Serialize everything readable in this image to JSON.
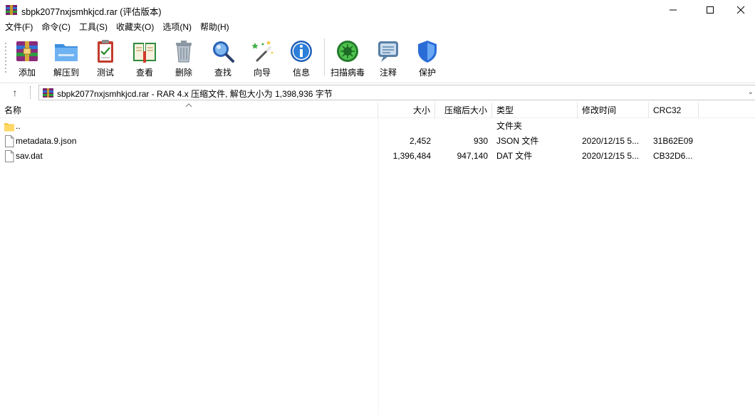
{
  "window": {
    "title": "sbpk2077nxjsmhkjcd.rar (评估版本)",
    "minimize_glyph": "—",
    "maximize_glyph": "☐",
    "close_glyph": "✕"
  },
  "menu": [
    {
      "label": "文件(F)"
    },
    {
      "label": "命令(C)"
    },
    {
      "label": "工具(S)"
    },
    {
      "label": "收藏夹(O)"
    },
    {
      "label": "选项(N)"
    },
    {
      "label": "帮助(H)"
    }
  ],
  "toolbar": [
    {
      "label": "添加",
      "icon": "add-archive-icon"
    },
    {
      "label": "解压到",
      "icon": "extract-folder-icon"
    },
    {
      "label": "测试",
      "icon": "test-clipboard-icon"
    },
    {
      "label": "查看",
      "icon": "view-book-icon"
    },
    {
      "label": "删除",
      "icon": "trash-icon"
    },
    {
      "label": "查找",
      "icon": "magnifier-icon"
    },
    {
      "label": "向导",
      "icon": "wizard-wand-icon"
    },
    {
      "label": "信息",
      "icon": "info-icon"
    },
    {
      "label": "扫描病毒",
      "icon": "virus-scan-icon"
    },
    {
      "label": "注释",
      "icon": "comment-icon"
    },
    {
      "label": "保护",
      "icon": "shield-icon"
    }
  ],
  "address": {
    "up_glyph": "↑",
    "path": "sbpk2077nxjsmhkjcd.rar - RAR 4.x 压缩文件, 解包大小为 1,398,936 字节",
    "dropdown_glyph": "⌄"
  },
  "columns": {
    "name": "名称",
    "size": "大小",
    "packed": "压缩后大小",
    "type": "类型",
    "modified": "修改时间",
    "crc": "CRC32"
  },
  "rows": [
    {
      "name": "..",
      "size": "",
      "packed": "",
      "type": "文件夹",
      "modified": "",
      "crc": "",
      "icon": "folder-icon"
    },
    {
      "name": "metadata.9.json",
      "size": "2,452",
      "packed": "930",
      "type": "JSON 文件",
      "modified": "2020/12/15 5...",
      "crc": "31B62E09",
      "icon": "file-icon"
    },
    {
      "name": "sav.dat",
      "size": "1,396,484",
      "packed": "947,140",
      "type": "DAT 文件",
      "modified": "2020/12/15 5...",
      "crc": "CB32D6...",
      "icon": "file-icon"
    }
  ]
}
